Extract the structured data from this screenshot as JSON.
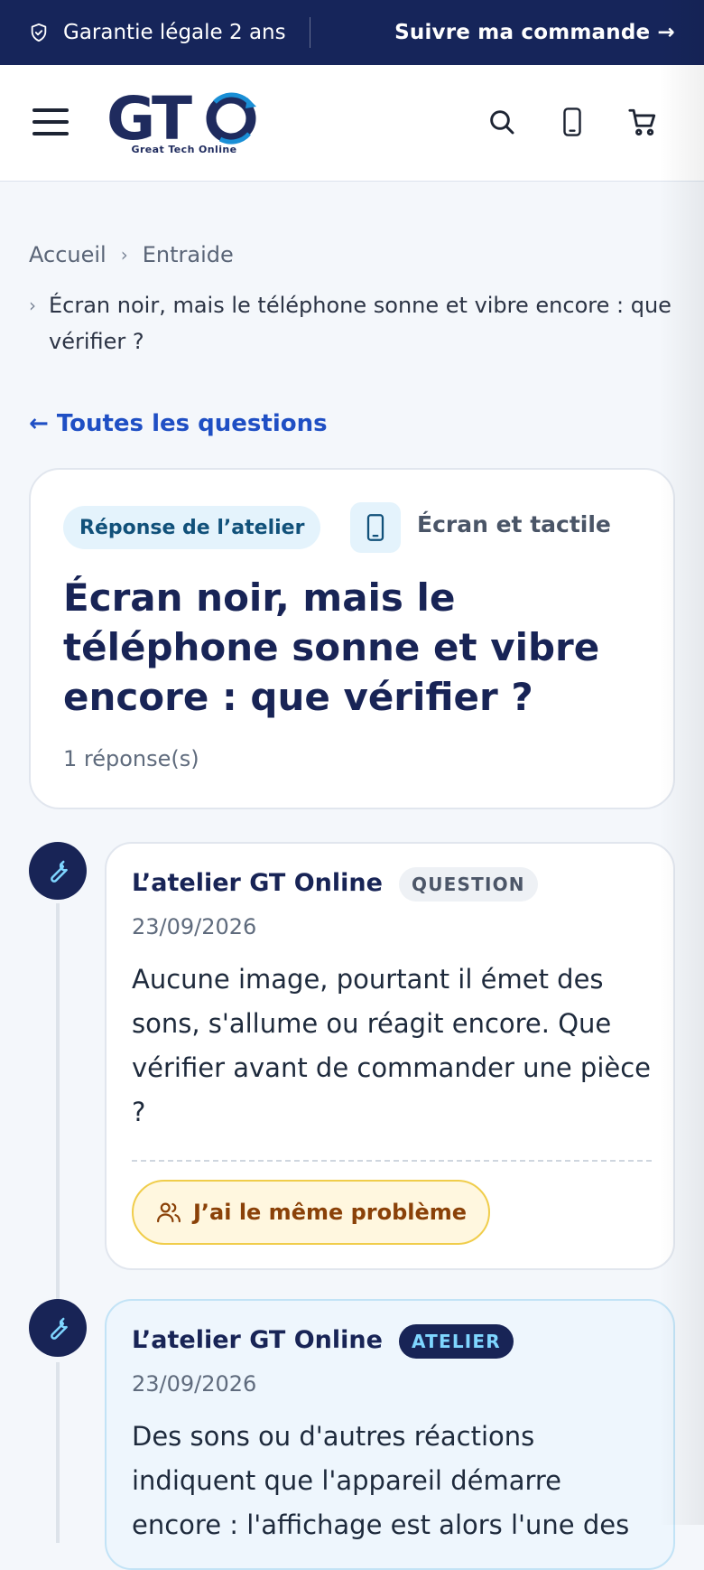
{
  "topbar": {
    "guarantee": "Garantie légale 2 ans",
    "track_order": "Suivre ma commande →"
  },
  "header": {
    "logo_text": "GTO",
    "logo_tagline": "Great Tech Online",
    "icons": [
      "menu-icon",
      "search-icon",
      "phone-icon",
      "cart-icon"
    ]
  },
  "breadcrumb": {
    "home": "Accueil",
    "section": "Entraide",
    "current": "Écran noir, mais le téléphone sonne et vibre encore : que vérifier ?",
    "separator": "›"
  },
  "back_link": "← Toutes les questions",
  "question_card": {
    "badge": "Réponse de l’atelier",
    "category": "Écran et tactile",
    "title": "Écran noir, mais le téléphone sonne et vibre encore : que vérifier ?",
    "reply_count": "1 réponse(s)"
  },
  "posts": [
    {
      "author": "L’atelier GT Online",
      "tag": "QUESTION",
      "date": "23/09/2026",
      "body": "Aucune image, pourtant il émet des sons, s'allume ou réagit encore. Que vérifier avant de commander une pièce ?",
      "same_problem_label": "J’ai le même problème"
    },
    {
      "author": "L’atelier GT Online",
      "tag": "ATELIER",
      "date": "23/09/2026",
      "body": "Des sons ou d'autres réactions indiquent que l'appareil démarre encore : l'affichage est alors l'une des"
    }
  ],
  "colors": {
    "navy": "#16255a",
    "link_blue": "#1f4fc4",
    "badge_bg": "#e4f3fc",
    "atelier_tag_text": "#7fd6ff",
    "same_button_bg": "#fff7df",
    "same_button_border": "#f0cd4b"
  }
}
